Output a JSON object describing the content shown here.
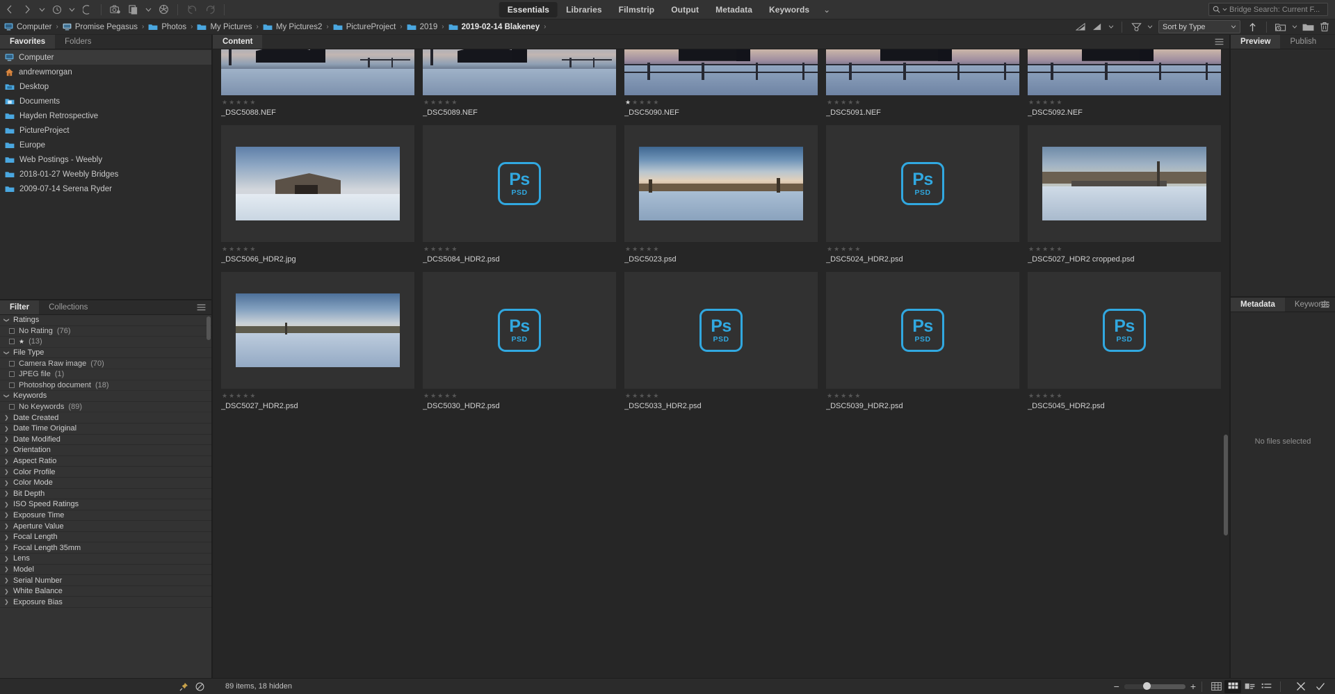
{
  "app": {
    "title": "Adobe Bridge"
  },
  "toolbar": {
    "back_icon": "back-arrow-icon",
    "forward_icon": "forward-arrow-icon",
    "recent_icon": "recent-folders-icon",
    "boomerang_icon": "reveal-icon",
    "photo_downloader_icon": "photo-downloader-icon",
    "refine_icon": "refine-icon",
    "open_in_camera_raw_icon": "camera-raw-icon",
    "rotate_ccw_icon": "rotate-counterclockwise-icon",
    "rotate_cw_icon": "rotate-clockwise-icon",
    "workspaces": [
      {
        "label": "Essentials",
        "active": true
      },
      {
        "label": "Libraries",
        "active": false
      },
      {
        "label": "Filmstrip",
        "active": false
      },
      {
        "label": "Output",
        "active": false
      },
      {
        "label": "Metadata",
        "active": false
      },
      {
        "label": "Keywords",
        "active": false
      }
    ],
    "workspace_overflow": "⌄"
  },
  "search": {
    "placeholder": "Bridge Search: Current F...",
    "value": "",
    "icon": "search-icon"
  },
  "breadcrumb": {
    "items": [
      {
        "label": "Computer",
        "icon": "computer-icon"
      },
      {
        "label": "Promise Pegasus",
        "icon": "drive-icon"
      },
      {
        "label": "Photos",
        "icon": "folder-icon"
      },
      {
        "label": "My Pictures",
        "icon": "folder-icon"
      },
      {
        "label": "My Pictures2",
        "icon": "folder-icon"
      },
      {
        "label": "PictureProject",
        "icon": "folder-icon"
      },
      {
        "label": "2019",
        "icon": "folder-icon"
      },
      {
        "label": "2019-02-14 Blakeney",
        "icon": "folder-icon"
      }
    ],
    "separator": "›"
  },
  "pathbar_tools": {
    "filter_rating_icon": "filter-rating-icon",
    "filter_rating_menu_icon": "filter-rating-menu-icon",
    "filter_items_icon": "filter-items-icon",
    "sort_label": "Sort by Type",
    "sort_direction_icon": "sort-ascending-icon",
    "new_folder_icon": "new-folder-icon",
    "open_recent_icon": "open-recent-icon",
    "delete_icon": "delete-icon"
  },
  "left_panel": {
    "tabs": [
      {
        "label": "Favorites",
        "active": true
      },
      {
        "label": "Folders",
        "active": false
      }
    ],
    "favorites": [
      {
        "label": "Computer",
        "icon": "computer-icon",
        "selected": true
      },
      {
        "label": "andrewmorgan",
        "icon": "home-icon",
        "selected": false
      },
      {
        "label": "Desktop",
        "icon": "desktop-folder-icon",
        "selected": false
      },
      {
        "label": "Documents",
        "icon": "documents-folder-icon",
        "selected": false
      },
      {
        "label": "Hayden Retrospective",
        "icon": "folder-icon",
        "selected": false
      },
      {
        "label": "PictureProject",
        "icon": "folder-icon",
        "selected": false
      },
      {
        "label": "Europe",
        "icon": "folder-icon",
        "selected": false
      },
      {
        "label": "Web Postings - Weebly",
        "icon": "folder-icon",
        "selected": false
      },
      {
        "label": "2018-01-27 Weebly Bridges",
        "icon": "folder-icon",
        "selected": false
      },
      {
        "label": "2009-07-14  Serena Ryder",
        "icon": "folder-icon",
        "selected": false
      }
    ]
  },
  "filter_panel": {
    "tabs": [
      {
        "label": "Filter",
        "active": true
      },
      {
        "label": "Collections",
        "active": false
      }
    ],
    "menu_icon": "panel-menu-icon",
    "groups": [
      {
        "label": "Ratings",
        "expanded": true,
        "items": [
          {
            "label": "No Rating",
            "count": "(76)",
            "stars": 0,
            "checked": false
          },
          {
            "label": "",
            "count": "(13)",
            "stars": 1,
            "checked": false
          }
        ]
      },
      {
        "label": "File Type",
        "expanded": true,
        "items": [
          {
            "label": "Camera Raw image",
            "count": "(70)",
            "stars": 0,
            "checked": false
          },
          {
            "label": "JPEG file",
            "count": "(1)",
            "stars": 0,
            "checked": false
          },
          {
            "label": "Photoshop document",
            "count": "(18)",
            "stars": 0,
            "checked": false
          }
        ]
      },
      {
        "label": "Keywords",
        "expanded": true,
        "items": [
          {
            "label": "No Keywords",
            "count": "(89)",
            "stars": 0,
            "checked": false
          }
        ]
      },
      {
        "label": "Date Created",
        "expanded": false,
        "items": []
      },
      {
        "label": "Date Time Original",
        "expanded": false,
        "items": []
      },
      {
        "label": "Date Modified",
        "expanded": false,
        "items": []
      },
      {
        "label": "Orientation",
        "expanded": false,
        "items": []
      },
      {
        "label": "Aspect Ratio",
        "expanded": false,
        "items": []
      },
      {
        "label": "Color Profile",
        "expanded": false,
        "items": []
      },
      {
        "label": "Color Mode",
        "expanded": false,
        "items": []
      },
      {
        "label": "Bit Depth",
        "expanded": false,
        "items": []
      },
      {
        "label": "ISO Speed Ratings",
        "expanded": false,
        "items": []
      },
      {
        "label": "Exposure Time",
        "expanded": false,
        "items": []
      },
      {
        "label": "Aperture Value",
        "expanded": false,
        "items": []
      },
      {
        "label": "Focal Length",
        "expanded": false,
        "items": []
      },
      {
        "label": "Focal Length 35mm",
        "expanded": false,
        "items": []
      },
      {
        "label": "Lens",
        "expanded": false,
        "items": []
      },
      {
        "label": "Model",
        "expanded": false,
        "items": []
      },
      {
        "label": "Serial Number",
        "expanded": false,
        "items": []
      },
      {
        "label": "White Balance",
        "expanded": false,
        "items": []
      },
      {
        "label": "Exposure Bias",
        "expanded": false,
        "items": []
      }
    ]
  },
  "content_panel": {
    "tab_label": "Content",
    "menu_icon": "panel-menu-icon",
    "items": [
      {
        "name": "_DSC5088.NEF",
        "kind": "photo",
        "scene": "barn-dusk",
        "rating": 0,
        "row": 1
      },
      {
        "name": "_DSC5089.NEF",
        "kind": "photo",
        "scene": "barn-dusk",
        "rating": 0,
        "row": 1
      },
      {
        "name": "_DSC5090.NEF",
        "kind": "photo",
        "scene": "barn-fence",
        "rating": 1,
        "row": 1
      },
      {
        "name": "_DSC5091.NEF",
        "kind": "photo",
        "scene": "barn-fence",
        "rating": 0,
        "row": 1
      },
      {
        "name": "_DSC5092.NEF",
        "kind": "photo",
        "scene": "barn-fence",
        "rating": 0,
        "row": 1
      },
      {
        "name": "_DSC5066_HDR2.jpg",
        "kind": "photo",
        "scene": "barn-field",
        "rating": 0,
        "row": 2
      },
      {
        "name": "_DCS5084_HDR2.psd",
        "kind": "psd",
        "scene": "",
        "rating": 0,
        "row": 2
      },
      {
        "name": "_DSC5023.psd",
        "kind": "photo",
        "scene": "river-sunset",
        "rating": 0,
        "row": 2
      },
      {
        "name": "_DSC5024_HDR2.psd",
        "kind": "psd",
        "scene": "",
        "rating": 0,
        "row": 2
      },
      {
        "name": "_DSC5027_HDR2 cropped.psd",
        "kind": "photo",
        "scene": "bridge-winter",
        "rating": 0,
        "row": 2
      },
      {
        "name": "_DSC5027_HDR2.psd",
        "kind": "photo",
        "scene": "river-blue",
        "rating": 0,
        "row": 3
      },
      {
        "name": "_DSC5030_HDR2.psd",
        "kind": "psd",
        "scene": "",
        "rating": 0,
        "row": 3
      },
      {
        "name": "_DSC5033_HDR2.psd",
        "kind": "psd",
        "scene": "",
        "rating": 0,
        "row": 3
      },
      {
        "name": "_DSC5039_HDR2.psd",
        "kind": "psd",
        "scene": "",
        "rating": 0,
        "row": 3
      },
      {
        "name": "_DSC5045_HDR2.psd",
        "kind": "psd",
        "scene": "",
        "rating": 0,
        "row": 3
      }
    ],
    "psd_icon": {
      "ps": "Ps",
      "label": "PSD"
    }
  },
  "right_panel": {
    "preview_tabs": [
      {
        "label": "Preview",
        "active": true
      },
      {
        "label": "Publish",
        "active": false
      }
    ],
    "metadata_tabs": [
      {
        "label": "Metadata",
        "active": true
      },
      {
        "label": "Keywords",
        "active": false
      }
    ],
    "menu_icon": "panel-menu-icon",
    "empty_message": "No files selected"
  },
  "statusbar": {
    "pin_icon": "pin-icon",
    "block_icon": "no-entry-icon",
    "items_text": "89 items, 18 hidden",
    "zoom_minus": "−",
    "zoom_plus": "+",
    "zoom_value": 31,
    "view_buttons": [
      {
        "icon": "grid-lock-view-icon",
        "active": false
      },
      {
        "icon": "thumbnail-view-icon",
        "active": true
      },
      {
        "icon": "details-view-icon",
        "active": false
      },
      {
        "icon": "list-view-icon",
        "active": false
      }
    ],
    "reject_icon": "close-icon",
    "accept_icon": "check-icon"
  },
  "colors": {
    "accent_blue": "#31a8e0",
    "folder_blue": "#4aa7e0",
    "panel_bg": "#2b2b2b",
    "content_bg": "#262626",
    "cell_bg": "#313131"
  }
}
